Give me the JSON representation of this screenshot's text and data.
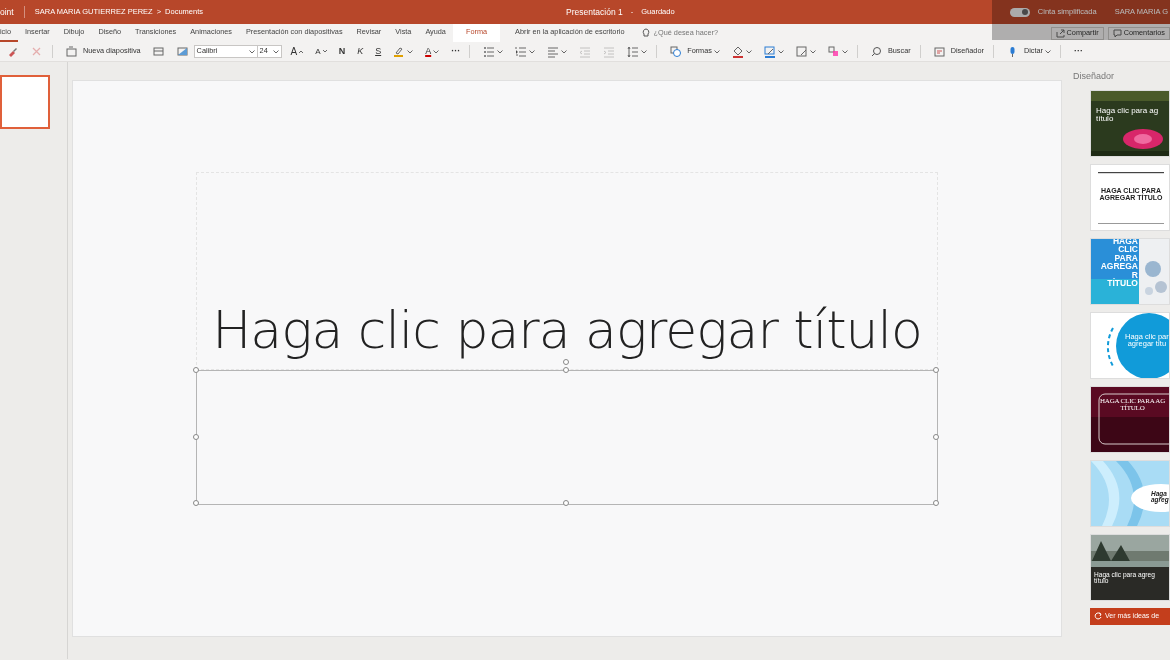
{
  "titlebar": {
    "app": "oint",
    "breadcrumb": [
      "SARA MARIA GUTIERREZ PEREZ",
      "Documents"
    ],
    "breadcrumb_separator": ">",
    "document": "Presentación 1",
    "separator": "-",
    "save_state": "Guardado",
    "simplified_ribbon": {
      "label": "Cinta simplificada",
      "on": true
    },
    "user": "SARA MARIA G"
  },
  "tabs": [
    {
      "label": "icio",
      "selected": true,
      "contextual": false
    },
    {
      "label": "Insertar",
      "selected": false,
      "contextual": false
    },
    {
      "label": "Dibujo",
      "selected": false,
      "contextual": false
    },
    {
      "label": "Diseño",
      "selected": false,
      "contextual": false
    },
    {
      "label": "Transiciones",
      "selected": false,
      "contextual": false
    },
    {
      "label": "Animaciones",
      "selected": false,
      "contextual": false
    },
    {
      "label": "Presentación con diapositivas",
      "selected": false,
      "contextual": false
    },
    {
      "label": "Revisar",
      "selected": false,
      "contextual": false
    },
    {
      "label": "Vista",
      "selected": false,
      "contextual": false
    },
    {
      "label": "Ayuda",
      "selected": false,
      "contextual": false
    },
    {
      "label": "Forma",
      "selected": false,
      "contextual": true
    }
  ],
  "open_desktop": "Abrir en la aplicación de escritorio",
  "search": {
    "placeholder": "¿Qué desea hacer?"
  },
  "actions": [
    {
      "label": "Compartir",
      "kind": "share"
    },
    {
      "label": "Comentarios",
      "kind": "comment"
    }
  ],
  "toolbar": [
    {
      "kind": "brush",
      "disabled": false
    },
    {
      "kind": "clear",
      "disabled": true
    },
    {
      "kind": "sep"
    },
    {
      "kind": "newslide",
      "label": "Nueva diapositiva",
      "disabled": false
    },
    {
      "kind": "layout",
      "disabled": false
    },
    {
      "kind": "background",
      "disabled": false
    },
    {
      "kind": "font",
      "value": "Calibri"
    },
    {
      "kind": "size",
      "value": "24"
    },
    {
      "kind": "grow",
      "label": "A",
      "disabled": false
    },
    {
      "kind": "shrink",
      "label": "A",
      "disabled": false
    },
    {
      "kind": "bold",
      "label": "N",
      "disabled": false
    },
    {
      "kind": "italic",
      "label": "K",
      "disabled": false
    },
    {
      "kind": "underline",
      "label": "S",
      "disabled": false
    },
    {
      "kind": "highlight",
      "disabled": false
    },
    {
      "kind": "fontcolor",
      "label": "A",
      "disabled": false
    },
    {
      "kind": "more",
      "label": "···",
      "disabled": false
    },
    {
      "kind": "sep"
    },
    {
      "kind": "bullets",
      "disabled": false
    },
    {
      "kind": "numbering",
      "disabled": false
    },
    {
      "kind": "align",
      "disabled": false
    },
    {
      "kind": "outdent",
      "disabled": true
    },
    {
      "kind": "indent",
      "disabled": true
    },
    {
      "kind": "spacing",
      "disabled": false
    },
    {
      "kind": "sep"
    },
    {
      "kind": "shapes",
      "label": "Formas",
      "disabled": false
    },
    {
      "kind": "fill",
      "disabled": false
    },
    {
      "kind": "outline",
      "disabled": false
    },
    {
      "kind": "effects",
      "disabled": false
    },
    {
      "kind": "arrange",
      "disabled": false
    },
    {
      "kind": "sep"
    },
    {
      "kind": "search",
      "label": "Buscar",
      "disabled": false
    },
    {
      "kind": "sep"
    },
    {
      "kind": "designer",
      "label": "Diseñador",
      "disabled": false
    },
    {
      "kind": "sep"
    },
    {
      "kind": "dictate",
      "label": "Dictar",
      "disabled": false
    },
    {
      "kind": "sep"
    },
    {
      "kind": "more",
      "label": "···",
      "disabled": false
    }
  ],
  "thumbnails": [
    {
      "selected": true
    }
  ],
  "slide": {
    "title_placeholder": "Haga clic para agregar título",
    "subtitle_selected": true
  },
  "designer": {
    "title": "Diseñador",
    "ideas": [
      {
        "kind": "flower",
        "lines": [
          "Haga clic para ag",
          "título"
        ]
      },
      {
        "kind": "lines",
        "lines": [
          "HAGA CLIC PARA",
          "AGREGAR TÍTULO"
        ]
      },
      {
        "kind": "blue",
        "lines": [
          "HAGA",
          "CLIC",
          "PARA",
          "AGREGA",
          "R",
          "TÍTULO"
        ]
      },
      {
        "kind": "circle",
        "lines": [
          "Haga clic par",
          "agregar títu"
        ]
      },
      {
        "kind": "frame",
        "lines": [
          "HAGA CLIC PARA AG",
          "TÍTULO"
        ]
      },
      {
        "kind": "waves",
        "lines": [
          "Haga",
          "agreg"
        ]
      },
      {
        "kind": "forest",
        "lines": [
          "Haga clic para agreg",
          "título"
        ]
      }
    ],
    "more_button": "Ver más ideas de"
  }
}
